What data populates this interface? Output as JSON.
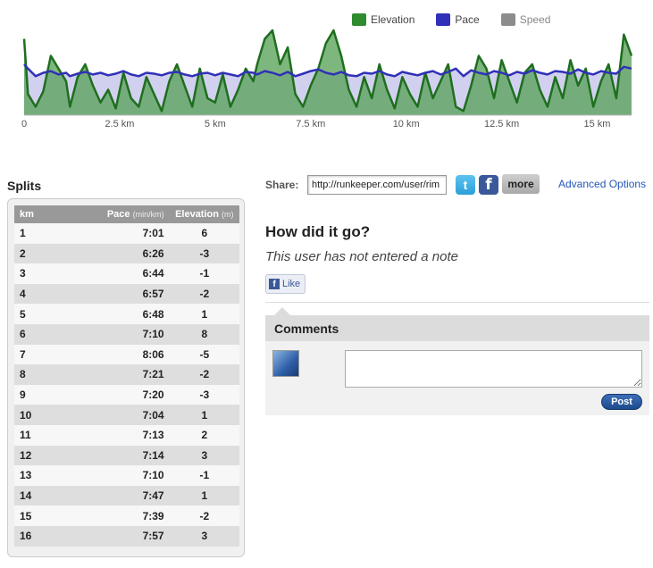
{
  "chart_data": {
    "type": "area",
    "xlabel": "",
    "ylabel": "",
    "x_tick_labels": [
      "0",
      "2.5 km",
      "5 km",
      "7.5 km",
      "10 km",
      "12.5 km",
      "15 km"
    ],
    "x_ticks_km": [
      0,
      2.5,
      5,
      7.5,
      10,
      12.5,
      15
    ],
    "xlim": [
      0,
      15.9
    ],
    "ylim": [
      0,
      100
    ],
    "legend_position": "top-right",
    "grid": false,
    "series": [
      {
        "name": "Elevation",
        "color": "#2e8b2e",
        "x": [
          0,
          0.1,
          0.3,
          0.5,
          0.7,
          0.9,
          1.1,
          1.2,
          1.4,
          1.6,
          1.8,
          2.0,
          2.2,
          2.4,
          2.6,
          2.8,
          3.0,
          3.2,
          3.4,
          3.6,
          3.8,
          4.0,
          4.2,
          4.4,
          4.6,
          4.8,
          5.0,
          5.2,
          5.4,
          5.6,
          5.8,
          6.0,
          6.1,
          6.3,
          6.5,
          6.7,
          6.9,
          7.1,
          7.3,
          7.5,
          7.7,
          7.9,
          8.1,
          8.3,
          8.5,
          8.7,
          8.9,
          9.1,
          9.3,
          9.5,
          9.7,
          9.9,
          10.1,
          10.3,
          10.5,
          10.7,
          10.9,
          11.1,
          11.3,
          11.5,
          11.7,
          11.9,
          12.1,
          12.3,
          12.5,
          12.7,
          12.9,
          13.1,
          13.3,
          13.5,
          13.7,
          13.9,
          14.1,
          14.3,
          14.5,
          14.7,
          14.9,
          15.1,
          15.3,
          15.5,
          15.7,
          15.9
        ],
        "values": [
          90,
          25,
          10,
          28,
          70,
          55,
          40,
          10,
          45,
          60,
          35,
          15,
          30,
          8,
          50,
          20,
          10,
          45,
          25,
          5,
          40,
          60,
          35,
          10,
          55,
          20,
          15,
          48,
          10,
          30,
          55,
          40,
          60,
          90,
          100,
          60,
          80,
          25,
          10,
          35,
          55,
          85,
          100,
          70,
          30,
          10,
          45,
          20,
          60,
          30,
          8,
          45,
          25,
          10,
          50,
          20,
          40,
          60,
          10,
          5,
          35,
          70,
          55,
          20,
          65,
          40,
          15,
          50,
          60,
          30,
          10,
          45,
          20,
          65,
          35,
          55,
          10,
          40,
          60,
          20,
          95,
          70
        ]
      },
      {
        "name": "Pace",
        "color": "#3030b8",
        "x": [
          0,
          0.1,
          0.3,
          0.5,
          0.7,
          0.9,
          1.1,
          1.2,
          1.4,
          1.6,
          1.8,
          2.0,
          2.2,
          2.4,
          2.6,
          2.8,
          3.0,
          3.2,
          3.4,
          3.6,
          3.8,
          4.0,
          4.2,
          4.4,
          4.6,
          4.8,
          5.0,
          5.2,
          5.4,
          5.6,
          5.8,
          6.0,
          6.1,
          6.3,
          6.5,
          6.7,
          6.9,
          7.1,
          7.3,
          7.5,
          7.7,
          7.9,
          8.1,
          8.3,
          8.5,
          8.7,
          8.9,
          9.1,
          9.3,
          9.5,
          9.7,
          9.9,
          10.1,
          10.3,
          10.5,
          10.7,
          10.9,
          11.1,
          11.3,
          11.5,
          11.7,
          11.9,
          12.1,
          12.3,
          12.5,
          12.7,
          12.9,
          13.1,
          13.3,
          13.5,
          13.7,
          13.9,
          14.1,
          14.3,
          14.5,
          14.7,
          14.9,
          15.1,
          15.3,
          15.5,
          15.7,
          15.9
        ],
        "values": [
          60,
          55,
          46,
          50,
          52,
          48,
          50,
          46,
          49,
          51,
          48,
          50,
          47,
          49,
          52,
          48,
          46,
          50,
          49,
          47,
          50,
          51,
          48,
          46,
          49,
          50,
          47,
          50,
          48,
          46,
          51,
          50,
          48,
          52,
          50,
          47,
          51,
          46,
          49,
          52,
          54,
          50,
          48,
          51,
          47,
          46,
          50,
          49,
          52,
          48,
          46,
          51,
          49,
          47,
          50,
          52,
          48,
          51,
          55,
          46,
          53,
          50,
          48,
          52,
          50,
          47,
          51,
          49,
          53,
          50,
          48,
          52,
          51,
          49,
          54,
          50,
          48,
          52,
          50,
          49,
          57,
          55
        ]
      },
      {
        "name": "Speed",
        "color": "#8c8c8c",
        "x": [],
        "values": []
      }
    ]
  },
  "splits": {
    "title": "Splits",
    "headers": {
      "km": "km",
      "pace": "Pace",
      "pace_unit": "(min/km)",
      "elevation": "Elevation",
      "elevation_unit": "(m)"
    },
    "rows": [
      {
        "km": "1",
        "pace": "7:01",
        "elev": "6"
      },
      {
        "km": "2",
        "pace": "6:26",
        "elev": "-3"
      },
      {
        "km": "3",
        "pace": "6:44",
        "elev": "-1"
      },
      {
        "km": "4",
        "pace": "6:57",
        "elev": "-2"
      },
      {
        "km": "5",
        "pace": "6:48",
        "elev": "1"
      },
      {
        "km": "6",
        "pace": "7:10",
        "elev": "8"
      },
      {
        "km": "7",
        "pace": "8:06",
        "elev": "-5"
      },
      {
        "km": "8",
        "pace": "7:21",
        "elev": "-2"
      },
      {
        "km": "9",
        "pace": "7:20",
        "elev": "-3"
      },
      {
        "km": "10",
        "pace": "7:04",
        "elev": "1"
      },
      {
        "km": "11",
        "pace": "7:13",
        "elev": "2"
      },
      {
        "km": "12",
        "pace": "7:14",
        "elev": "3"
      },
      {
        "km": "13",
        "pace": "7:10",
        "elev": "-1"
      },
      {
        "km": "14",
        "pace": "7:47",
        "elev": "1"
      },
      {
        "km": "15",
        "pace": "7:39",
        "elev": "-2"
      },
      {
        "km": "16",
        "pace": "7:57",
        "elev": "3"
      }
    ]
  },
  "share": {
    "label": "Share:",
    "url_value": "http://runkeeper.com/user/rim",
    "twitter_icon": "t",
    "facebook_icon": "f",
    "more_label": "more",
    "advanced_label": "Advanced Options"
  },
  "note": {
    "title": "How did it go?",
    "text": "This user has not entered a note",
    "like_icon": "f",
    "like_label": "Like"
  },
  "comments": {
    "title": "Comments",
    "input_value": "",
    "post_label": "Post"
  }
}
